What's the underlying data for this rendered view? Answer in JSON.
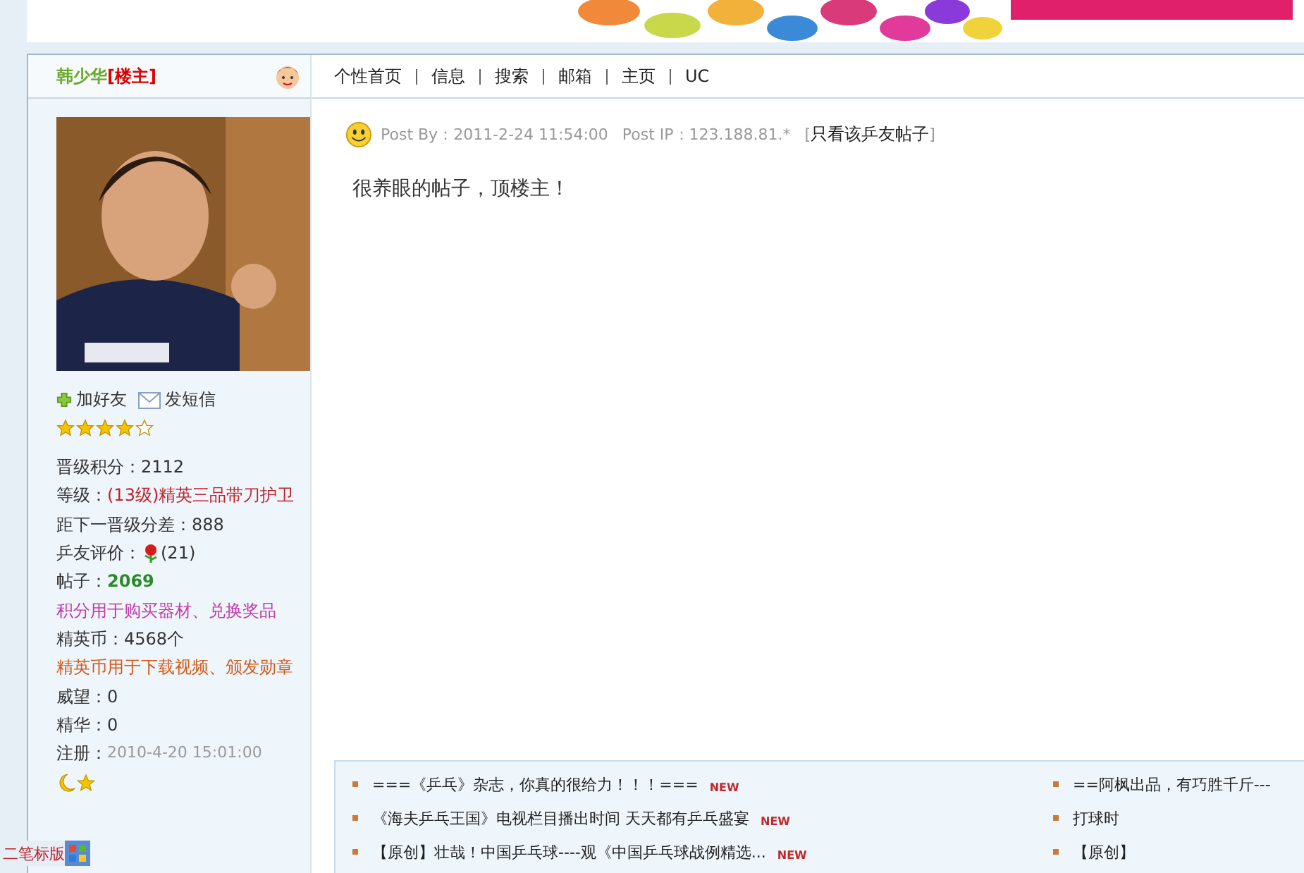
{
  "user": {
    "name": "韩少华",
    "role": "[楼主]",
    "actions": [
      {
        "kind": "add",
        "label": "加好友"
      },
      {
        "kind": "mail",
        "label": "发短信"
      }
    ],
    "stars": 4,
    "stats": [
      {
        "kind": "plain",
        "label": "晋级积分：",
        "value": "2112"
      },
      {
        "kind": "red",
        "label": "等级：",
        "value": "(13级)精英三品带刀护卫"
      },
      {
        "kind": "plain",
        "label": "距下一晋级分差：",
        "value": "888"
      },
      {
        "kind": "flower",
        "label": "乒友评价：",
        "value": "(21)"
      },
      {
        "kind": "green",
        "label": "帖子：",
        "value": "2069"
      },
      {
        "kind": "note_pink",
        "value": "积分用于购买器材、兑换奖品"
      },
      {
        "kind": "plain",
        "label": "精英币：",
        "value": "4568个"
      },
      {
        "kind": "note_orange",
        "value": "精英币用于下载视频、颁发勋章"
      },
      {
        "kind": "plain",
        "label": "威望：",
        "value": "0"
      },
      {
        "kind": "plain",
        "label": "精华：",
        "value": "0"
      },
      {
        "kind": "date",
        "label": "注册：",
        "value": "2010-4-20 15:01:00"
      }
    ]
  },
  "nav": [
    "个性首页",
    "信息",
    "搜索",
    "邮箱",
    "主页",
    "UC"
  ],
  "post": {
    "by_label": "Post By：",
    "time": "2011-2-24 11:54:00",
    "ip_label": "Post IP：",
    "ip": "123.188.81.*",
    "open": "[",
    "link": "只看该乒友帖子",
    "close": "]",
    "body": "很养眼的帖子，顶楼主！"
  },
  "threads_left": [
    {
      "title": "===《乒乓》杂志，你真的很给力！！！===",
      "badge": "NEW"
    },
    {
      "title": "《海夫乒乓王国》电视栏目播出时间  天天都有乒乓盛宴",
      "badge": "NEW"
    },
    {
      "title": "【原创】壮哉！中国乒乓球----观《中国乒乓球战例精选...",
      "badge": "NEW"
    }
  ],
  "threads_right": [
    "==阿枫出品，有巧胜千斤---",
    "打球时",
    "【原创】"
  ],
  "corner_label": "二笔标版"
}
